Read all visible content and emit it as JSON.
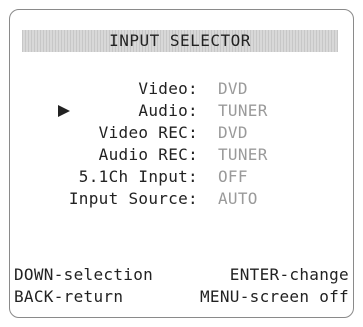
{
  "screen": {
    "title": "INPUT SELECTOR"
  },
  "menu": {
    "items": [
      {
        "label": "Video:",
        "value": "DVD"
      },
      {
        "label": "Audio:",
        "value": "TUNER"
      },
      {
        "label": "Video REC:",
        "value": "DVD"
      },
      {
        "label": "Audio REC:",
        "value": "TUNER"
      },
      {
        "label": "5.1Ch Input:",
        "value": "OFF"
      },
      {
        "label": "Input Source:",
        "value": "AUTO"
      }
    ],
    "cursor_icon": "right-triangle-icon"
  },
  "help": {
    "down": "DOWN-selection",
    "enter": "ENTER-change",
    "back": "BACK-return",
    "menu": "MENU-screen off"
  },
  "colors": {
    "text": "#222222",
    "value_text": "#9a9a9a",
    "border": "#8a8a8a",
    "title_bar": "#d8d8d8"
  }
}
